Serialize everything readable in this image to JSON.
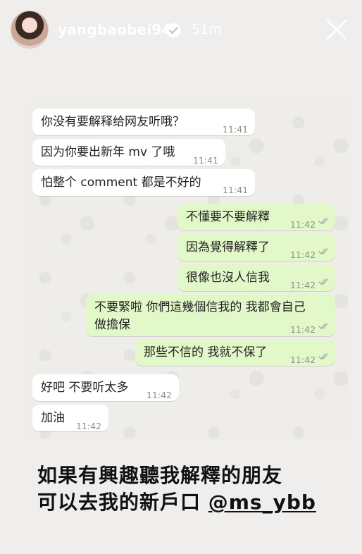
{
  "header": {
    "username": "yangbaobei94",
    "time_ago": "51m",
    "avatar_icon": "profile-photo",
    "verified_icon": "verified-badge-icon",
    "close_icon": "close-icon"
  },
  "chat": {
    "messages": [
      {
        "direction": "incoming",
        "text": "你没有要解释给网友听哦？",
        "time": "11:41"
      },
      {
        "direction": "incoming",
        "text": "因为你要出新年 mv 了哦",
        "time": "11:41"
      },
      {
        "direction": "incoming",
        "text": "怕整个 comment 都是不好的",
        "time": "11:41"
      },
      {
        "direction": "outgoing",
        "text": "不懂要不要解釋",
        "time": "11:42",
        "status": "read"
      },
      {
        "direction": "outgoing",
        "text": "因為覺得解釋了",
        "time": "11:42",
        "status": "read"
      },
      {
        "direction": "outgoing",
        "text": "很像也沒人信我",
        "time": "11:42",
        "status": "read"
      },
      {
        "direction": "outgoing",
        "text": "不要緊啦 你們這幾個信我的 我都會自己\n做擔保",
        "time": "11:42",
        "status": "read"
      },
      {
        "direction": "outgoing",
        "text": "那些不信的 我就不保了",
        "time": "11:42",
        "status": "read"
      },
      {
        "direction": "incoming",
        "text": "好吧 不要听太多",
        "time": "11:42"
      },
      {
        "direction": "incoming",
        "text": "加油",
        "time": "11:42"
      }
    ]
  },
  "caption": {
    "line1": "如果有興趣聽我解釋的朋友",
    "line2_prefix": "可以去我的新戶口 ",
    "mention": "@ms_ybb"
  },
  "colors": {
    "outgoing_bubble": "#e2f8c8",
    "incoming_bubble": "#ffffff",
    "chat_background": "#eeede9",
    "story_background": "#efeeec"
  }
}
